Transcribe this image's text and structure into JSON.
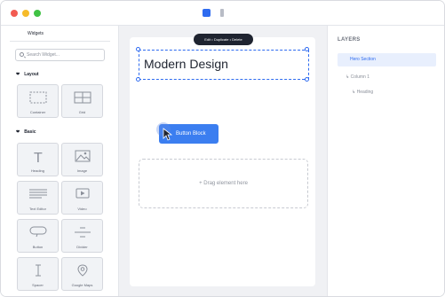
{
  "window": {
    "title_controls": [
      "close-icon",
      "minimize-icon",
      "maximize-icon"
    ],
    "device_icons": [
      "desktop-icon",
      "tablet-icon"
    ]
  },
  "left_panel": {
    "tab_label": "Widgets",
    "search_placeholder": "Search Widget...",
    "sections": [
      {
        "title": "Layout",
        "widgets": [
          {
            "label": "Container",
            "icon": "container-icon"
          },
          {
            "label": "Grid",
            "icon": "grid-icon"
          }
        ]
      },
      {
        "title": "Basic",
        "widgets": [
          {
            "label": "Heading",
            "icon": "heading-icon"
          },
          {
            "label": "Image",
            "icon": "image-icon"
          },
          {
            "label": "Text Editor",
            "icon": "text-editor-icon"
          },
          {
            "label": "Video",
            "icon": "video-icon"
          },
          {
            "label": "Button",
            "icon": "button-icon"
          },
          {
            "label": "Divider",
            "icon": "divider-icon"
          },
          {
            "label": "Spacer",
            "icon": "spacer-icon"
          },
          {
            "label": "Google Maps",
            "icon": "map-pin-icon"
          }
        ]
      }
    ]
  },
  "canvas": {
    "toolbar_text": "Edit • Duplicate • Delete",
    "heading_text": "Modern Design",
    "button_text": "Button Block",
    "drop_text": "+ Drag element here"
  },
  "right_panel": {
    "title": "LAYERS",
    "layers": [
      {
        "label": "Hero Section"
      },
      {
        "label": "↳ Column 1"
      },
      {
        "label": "↳ Heading"
      }
    ]
  },
  "colors": {
    "accent": "#2e6bf0",
    "button": "#3b7ef0",
    "toolbar": "#1f2430"
  }
}
